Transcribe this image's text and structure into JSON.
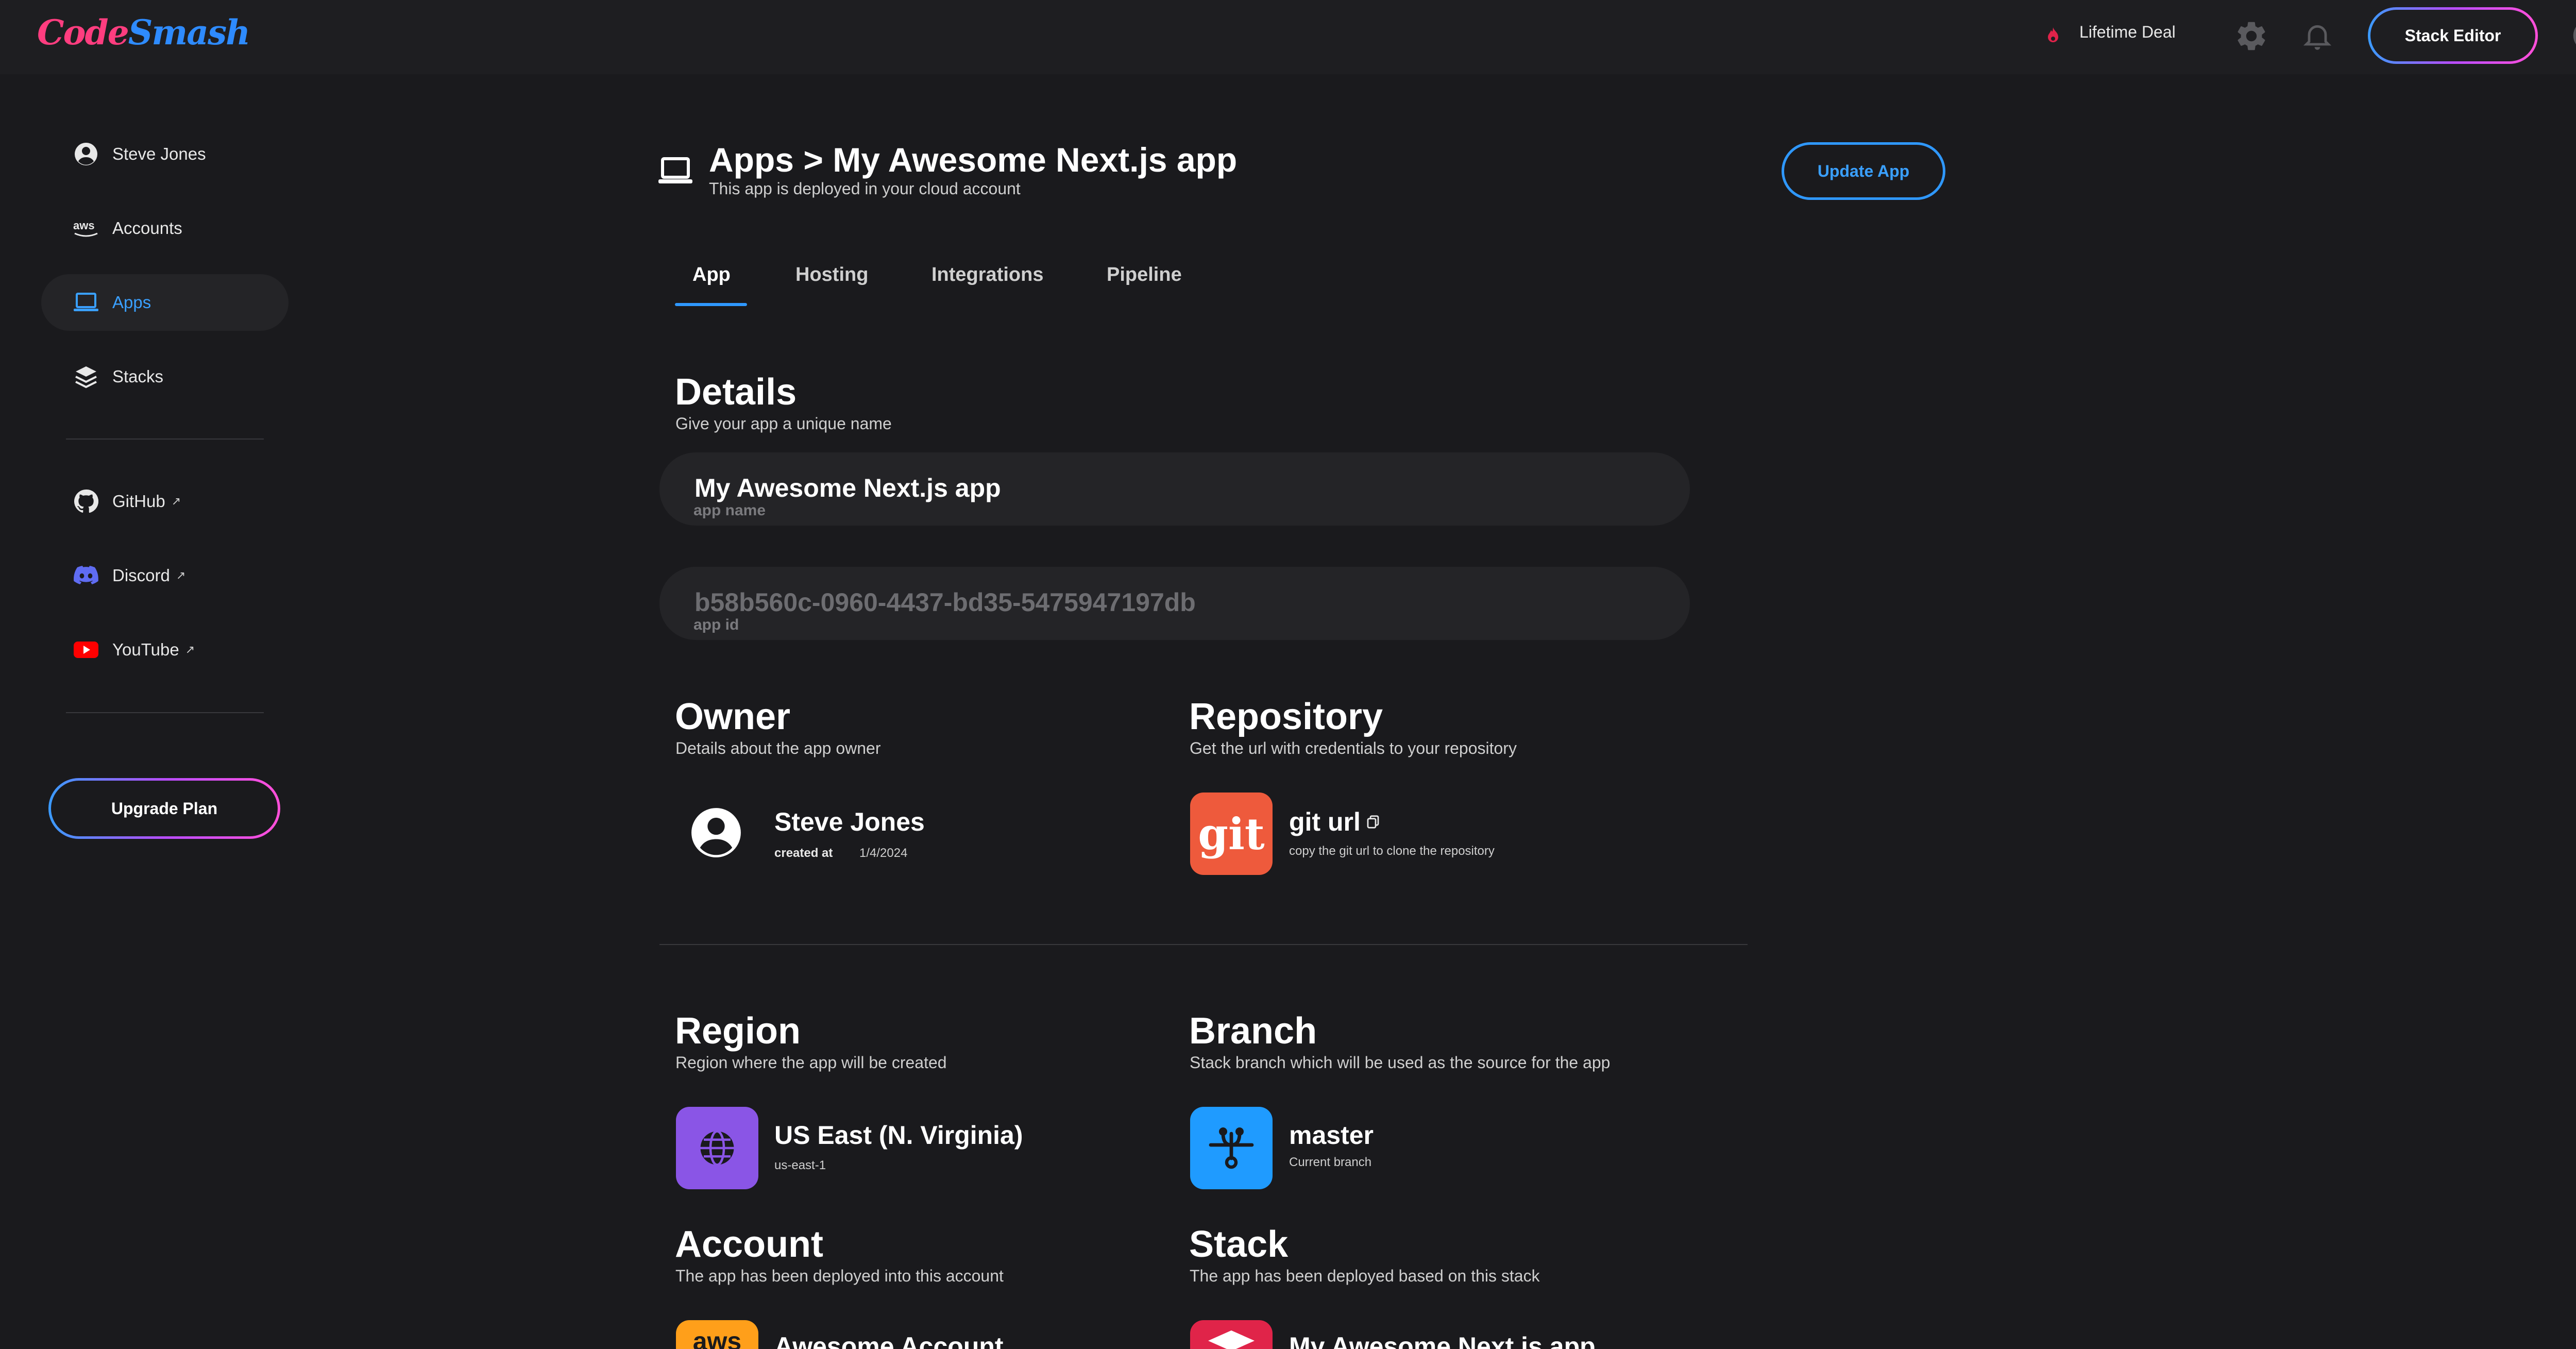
{
  "topbar": {
    "logo_part1": "Code",
    "logo_part2": "Smash",
    "lifetime_deal": "Lifetime Deal",
    "stack_editor": "Stack Editor",
    "icons": [
      "flame-icon",
      "gear-icon",
      "bell-icon",
      "user-avatar-icon"
    ]
  },
  "sidebar": {
    "items": [
      {
        "label": "Steve Jones",
        "icon": "user-circle-icon"
      },
      {
        "label": "Accounts",
        "icon": "aws-icon"
      },
      {
        "label": "Apps",
        "icon": "laptop-icon",
        "active": true
      },
      {
        "label": "Stacks",
        "icon": "layers-icon"
      }
    ],
    "links": [
      {
        "label": "GitHub",
        "icon": "github-icon"
      },
      {
        "label": "Discord",
        "icon": "discord-icon"
      },
      {
        "label": "YouTube",
        "icon": "youtube-icon"
      }
    ],
    "upgrade": "Upgrade Plan"
  },
  "header": {
    "title": "Apps > My Awesome Next.js app",
    "subtitle": "This app is deployed in your cloud account",
    "update_button": "Update App"
  },
  "tabs": [
    "App",
    "Hosting",
    "Integrations",
    "Pipeline"
  ],
  "details": {
    "title": "Details",
    "subtitle": "Give your app a unique name",
    "app_name_value": "My Awesome Next.js app",
    "app_name_label": "app name",
    "app_id_value": "b58b560c-0960-4437-bd35-5475947197db",
    "app_id_label": "app id"
  },
  "owner": {
    "title": "Owner",
    "subtitle": "Details about the app owner",
    "name": "Steve Jones",
    "created_label": "created at",
    "created_value": "1/4/2024"
  },
  "repository": {
    "title": "Repository",
    "subtitle": "Get the url with credentials to your repository",
    "tile_text": "git",
    "name": "git url",
    "caption": "copy the git url to clone the repository"
  },
  "region": {
    "title": "Region",
    "subtitle": "Region where the app will be created",
    "name": "US East (N. Virginia)",
    "code": "us-east-1"
  },
  "branch": {
    "title": "Branch",
    "subtitle": "Stack branch which will be used as the source for the app",
    "name": "master",
    "caption": "Current branch"
  },
  "account": {
    "title": "Account",
    "subtitle": "The app has been deployed into this account",
    "name": "Awesome Account",
    "tile_text": "aws"
  },
  "stack": {
    "title": "Stack",
    "subtitle": "The app has been deployed based on this stack",
    "name": "My Awesome Next.js app"
  },
  "colors": {
    "background": "#1a1a1d",
    "accent_blue": "#2f98ff",
    "git": "#ee5a3c",
    "region": "#8a55e6",
    "branch": "#1f9bff",
    "aws": "#ff9f1a",
    "stack": "#e02449"
  }
}
